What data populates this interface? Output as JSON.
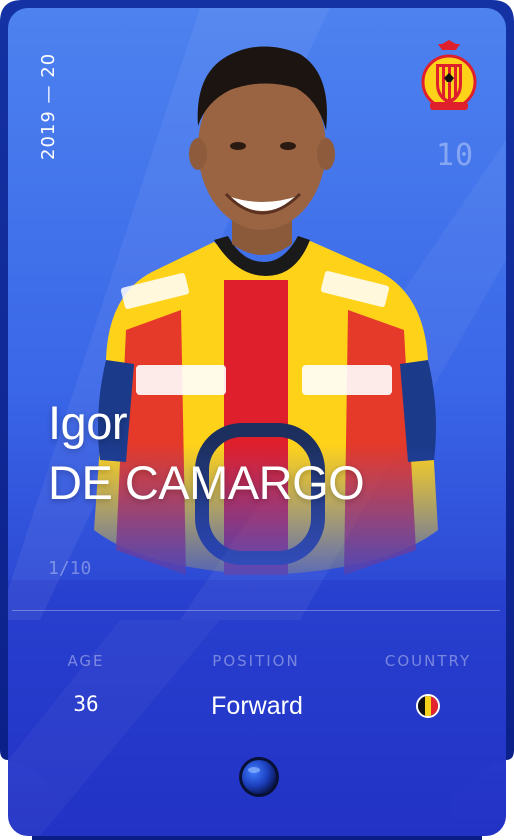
{
  "card": {
    "season": "2019 — 20",
    "jersey_number": "10",
    "first_name": "Igor",
    "last_name": "DE CAMARGO",
    "serial": "1/10",
    "colors": {
      "background_top": "#4f7ff0",
      "background_bottom": "#2233c6",
      "frame": "#0a1d7d",
      "club_yellow": "#ffd21a",
      "club_red": "#e01f2d"
    }
  },
  "stats": {
    "age_label": "AGE",
    "age_value": "36",
    "position_label": "POSITION",
    "position_value": "Forward",
    "country_label": "COUNTRY",
    "country_flag": "belgium-flag",
    "flag_colors": [
      "#111111",
      "#f5d31a",
      "#e3262d"
    ]
  },
  "icons": {
    "club": "kv-mechelen-crest-icon",
    "rarity": "rarity-gem-icon"
  }
}
